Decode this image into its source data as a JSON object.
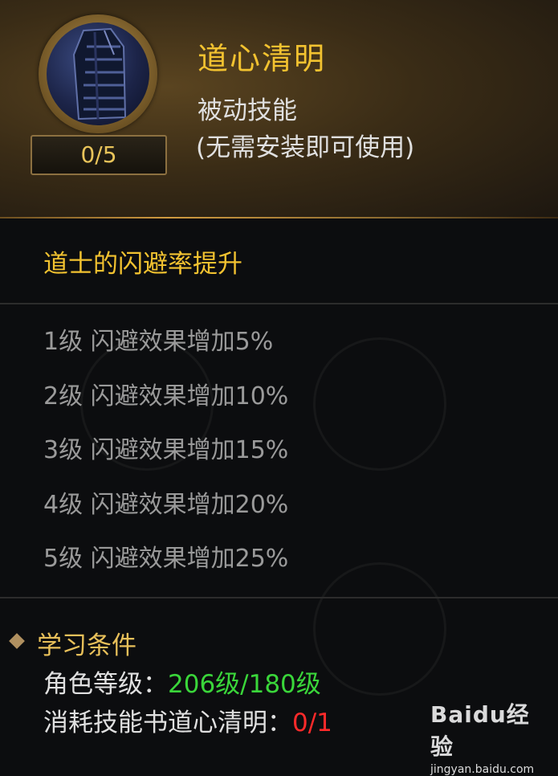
{
  "skill": {
    "name": "道心清明",
    "type": "被动技能",
    "note": "(无需安装即可使用)",
    "level": "0/5",
    "summary": "道士的闪避率提升"
  },
  "effects": [
    "1级 闪避效果增加5%",
    "2级 闪避效果增加10%",
    "3级 闪避效果增加15%",
    "4级 闪避效果增加20%",
    "5级 闪避效果增加25%"
  ],
  "requirements": {
    "title": "学习条件",
    "role_level_label": "角色等级：",
    "role_level_value": "206级/180级",
    "book_label": "消耗技能书道心清明：",
    "book_value": "0/1"
  },
  "colors": {
    "title_gold": "#f2c230",
    "requirement_met": "#3ad63a",
    "requirement_unmet": "#ff2a2a"
  },
  "watermark": {
    "brand": "Baidu经验",
    "url": "jingyan.baidu.com"
  }
}
